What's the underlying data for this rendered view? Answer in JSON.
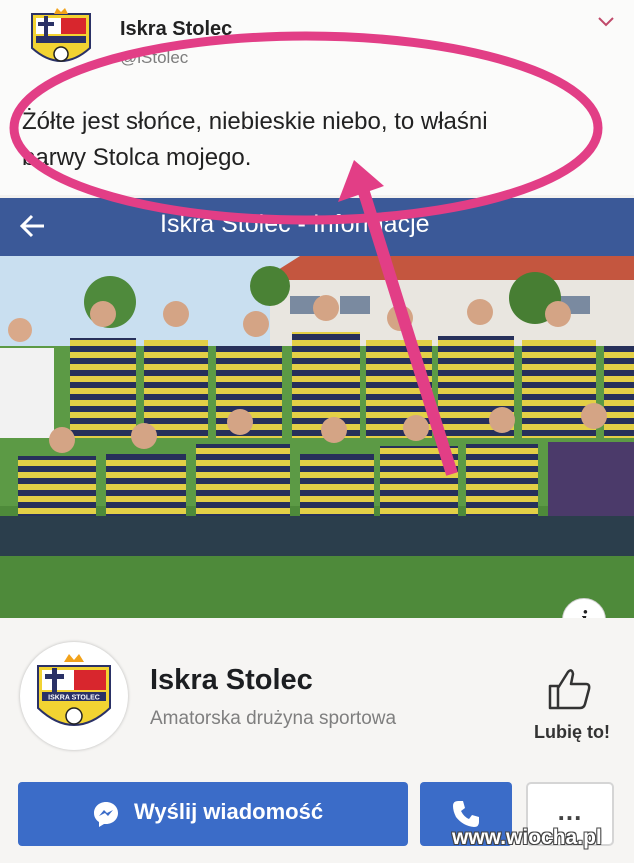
{
  "tweet": {
    "name": "Iskra Stolec",
    "handle": "@iStolec",
    "text": "Żółte jest słońce, niebieskie niebo, to właśni\nbarwy Stolca mojego."
  },
  "fb_header": {
    "title": "Iskra Stolec - Informacje"
  },
  "page": {
    "name": "Iskra Stolec",
    "category": "Amatorska drużyna sportowa",
    "like_label": "Lubię to!",
    "info_glyph": "i"
  },
  "buttons": {
    "message_label": "Wyślij wiadomość",
    "more_label": "..."
  },
  "logo_text": "ISKRA STOLEC",
  "watermark": "www.wiocha.pl",
  "colors": {
    "facebook_blue": "#3b5998",
    "button_blue": "#3b6cc8",
    "annotation_pink": "#e23e86",
    "jersey_yellow": "#e3cf46",
    "jersey_navy": "#27305a"
  },
  "icons": [
    "club-crest-icon",
    "chevron-down-icon",
    "back-arrow-icon",
    "info-icon",
    "thumbs-up-icon",
    "messenger-icon",
    "phone-icon",
    "more-icon"
  ]
}
